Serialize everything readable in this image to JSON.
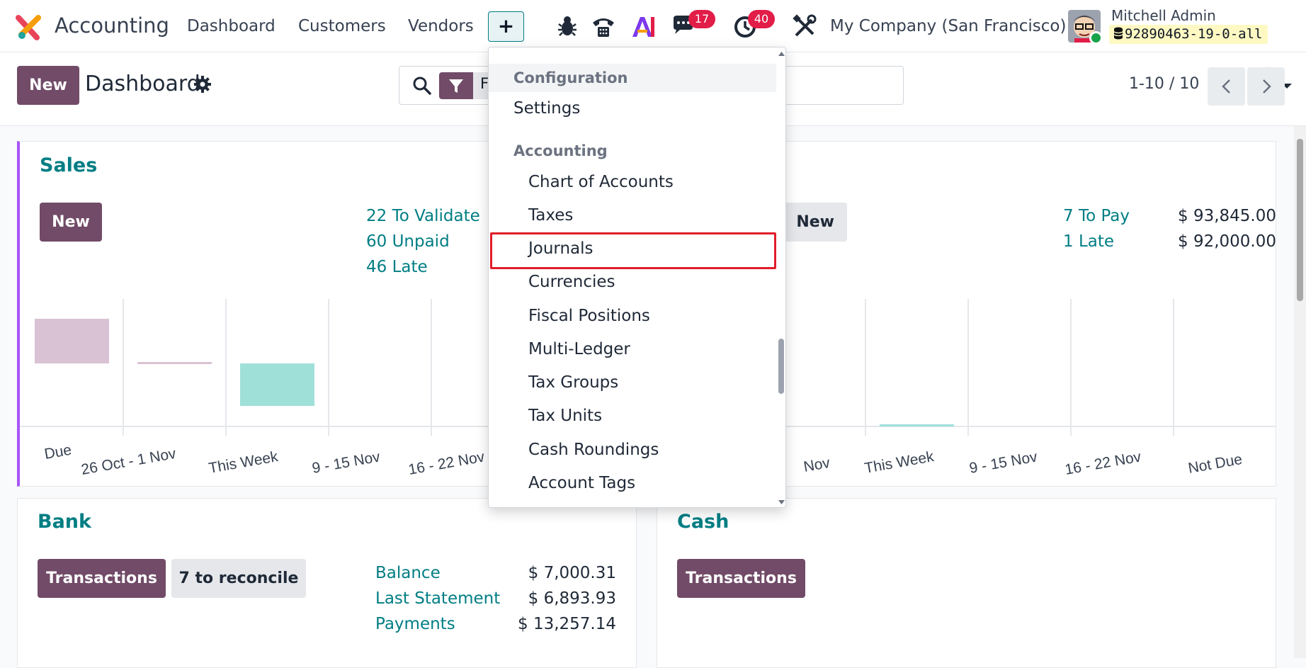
{
  "app": {
    "name": "Accounting"
  },
  "navbar": {
    "menus": [
      "Dashboard",
      "Customers",
      "Vendors"
    ],
    "plus_label": "+",
    "messages_count": "17",
    "activities_count": "40",
    "company": "My Company (San Francisco)",
    "user": "Mitchell Admin",
    "database": "92890463-19-0-all"
  },
  "control_panel": {
    "new_label": "New",
    "title": "Dashboard",
    "facet_text": "F",
    "pager": "1-10 / 10"
  },
  "sales": {
    "title": "Sales",
    "new_label": "New",
    "links": [
      "22 To Validate",
      "60 Unpaid",
      "46 Late"
    ],
    "chart_categories": [
      "Due",
      "26 Oct - 1 Nov",
      "This Week",
      "9 - 15 Nov",
      "16 - 22 Nov"
    ]
  },
  "purchases": {
    "new_label": "New",
    "links": [
      "7 To Pay",
      "1 Late"
    ],
    "amounts": [
      "$ 93,845.00",
      "$ 92,000.00"
    ],
    "chart_categories": [
      "Nov",
      "This Week",
      "9 - 15 Nov",
      "16 - 22 Nov",
      "Not Due"
    ]
  },
  "bank": {
    "title": "Bank",
    "transactions_label": "Transactions",
    "reconcile_label": "7 to reconcile",
    "rows": [
      {
        "label": "Balance",
        "amount": "$ 7,000.31"
      },
      {
        "label": "Last Statement",
        "amount": "$ 6,893.93"
      },
      {
        "label": "Payments",
        "amount": "$ 13,257.14"
      }
    ]
  },
  "cash": {
    "title": "Cash",
    "transactions_label": "Transactions"
  },
  "dropdown": {
    "sections": [
      {
        "header": "Configuration",
        "items": [
          "Settings"
        ]
      },
      {
        "header": "Accounting",
        "items": [
          "Chart of Accounts",
          "Taxes",
          "Journals",
          "Currencies",
          "Fiscal Positions",
          "Multi-Ledger",
          "Tax Groups",
          "Tax Units",
          "Cash Roundings",
          "Account Tags"
        ]
      }
    ],
    "highlighted_item": "Journals"
  },
  "colors": {
    "brand": "#714b67",
    "teal": "#017e84",
    "badge": "#e11d48",
    "highlight": "#e11d2a"
  }
}
